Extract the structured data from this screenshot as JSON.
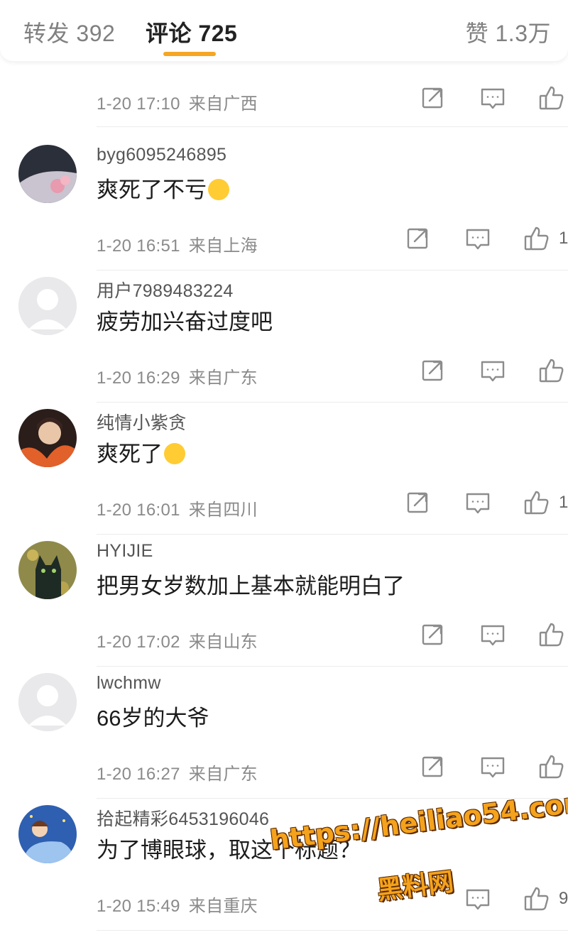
{
  "tabs": {
    "repost": "转发 392",
    "comment": "评论 725",
    "like": "赞 1.3万"
  },
  "partial_comment": {
    "time": "1-20 17:10",
    "location": "来自广西",
    "likes": ""
  },
  "comments": [
    {
      "username": "byg6095246895",
      "text": "爽死了不亏",
      "emoji": "crying-face-emoji",
      "time": "1-20 16:51",
      "location": "来自上海",
      "likes": "1"
    },
    {
      "username": "用户7989483224",
      "text": "疲劳加兴奋过度吧",
      "emoji": "",
      "time": "1-20 16:29",
      "location": "来自广东",
      "likes": ""
    },
    {
      "username": "纯情小紫贪",
      "text": "爽死了",
      "emoji": "thinking-face-emoji",
      "time": "1-20 16:01",
      "location": "来自四川",
      "likes": "1"
    },
    {
      "username": "HYIJIE",
      "text": "把男女岁数加上基本就能明白了",
      "emoji": "",
      "time": "1-20 17:02",
      "location": "来自山东",
      "likes": ""
    },
    {
      "username": "lwchmw",
      "text": "66岁的大爷",
      "emoji": "",
      "time": "1-20 16:27",
      "location": "来自广东",
      "likes": ""
    },
    {
      "username": "拾起精彩6453196046",
      "text": "为了博眼球，取这个标题？",
      "emoji": "",
      "time": "1-20 15:49",
      "location": "来自重庆",
      "likes": "9"
    }
  ],
  "watermark": {
    "url": "https://heiliao54.com",
    "name": "黑料网"
  },
  "colors": {
    "accent": "#f5a623",
    "meta_text": "#8a8a8a",
    "watermark": "#f5a21c"
  },
  "icons": {
    "repost": "repost-icon",
    "comment": "comment-icon",
    "like": "thumbs-up-icon"
  }
}
